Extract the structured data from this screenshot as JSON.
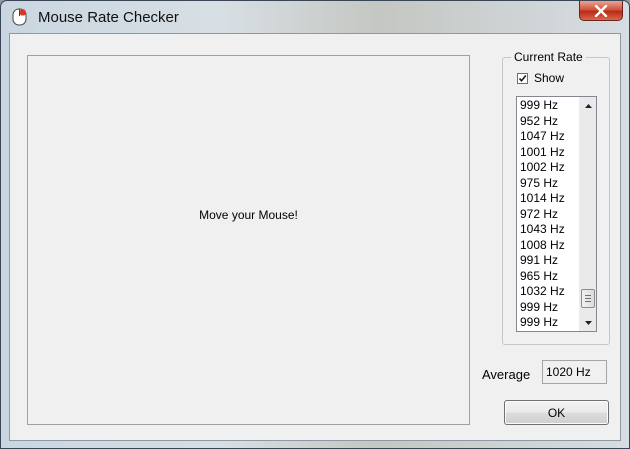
{
  "window": {
    "title": "Mouse Rate Checker",
    "app_icon": "mouse-icon",
    "close_icon": "close-icon"
  },
  "canvas": {
    "prompt": "Move your Mouse!"
  },
  "current_rate": {
    "group_title": "Current Rate",
    "show_label": "Show",
    "show_checked": true,
    "items": [
      "999 Hz",
      "952 Hz",
      "1047 Hz",
      "1001 Hz",
      "1002 Hz",
      "975 Hz",
      "1014 Hz",
      "972 Hz",
      "1043 Hz",
      "1008 Hz",
      "991 Hz",
      "965 Hz",
      "1032 Hz",
      "999 Hz",
      "999 Hz"
    ]
  },
  "average": {
    "label": "Average",
    "value": "1020 Hz"
  },
  "buttons": {
    "ok_label": "OK"
  },
  "colors": {
    "close_red": "#c8402a",
    "dialog_bg": "#f0f0f0"
  }
}
